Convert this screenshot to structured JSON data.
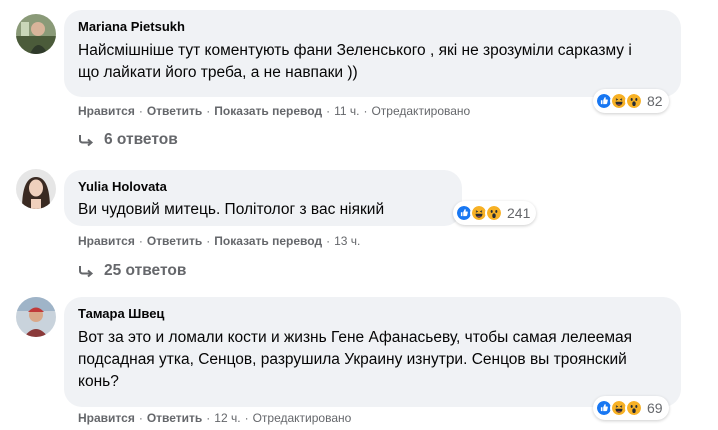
{
  "comments": [
    {
      "author": "Mariana Pietsukh",
      "text": "Найсмішніше тут коментують фани Зеленського , які не зрозуміли сарказму і що лайкати його треба, а не навпаки ))",
      "like": "Нравится",
      "reply": "Ответить",
      "translate": "Показать перевод",
      "time": "11 ч.",
      "edited": "Отредактировано",
      "reaction_count": "82",
      "replies_label": "6 ответов",
      "reaction_icons": [
        "like-icon",
        "haha-icon",
        "wow-icon"
      ]
    },
    {
      "author": "Yulia Holovata",
      "text": "Ви чудовий митець. Політолог з вас ніякий",
      "like": "Нравится",
      "reply": "Ответить",
      "translate": "Показать перевод",
      "time": "13 ч.",
      "reaction_count": "241",
      "replies_label": "25 ответов",
      "reaction_icons": [
        "like-icon",
        "haha-icon",
        "wow-icon"
      ]
    },
    {
      "author": "Тамара Швец",
      "text": "Вот за это и ломали кости и жизнь Гене Афанасьеву, чтобы самая лелеемая подсадная утка, Сенцов, разрушила Украину изнутри. Сенцов вы троянский конь?",
      "like": "Нравится",
      "reply": "Ответить",
      "time": "12 ч.",
      "edited": "Отредактировано",
      "reaction_count": "69",
      "reaction_icons": [
        "like-icon",
        "haha-icon",
        "wow-icon"
      ]
    }
  ],
  "colors": {
    "bubble": "#f0f2f5",
    "secondary_text": "#65676b",
    "like_blue": "#1877f2",
    "emoji_yellow": "#f7b125"
  }
}
